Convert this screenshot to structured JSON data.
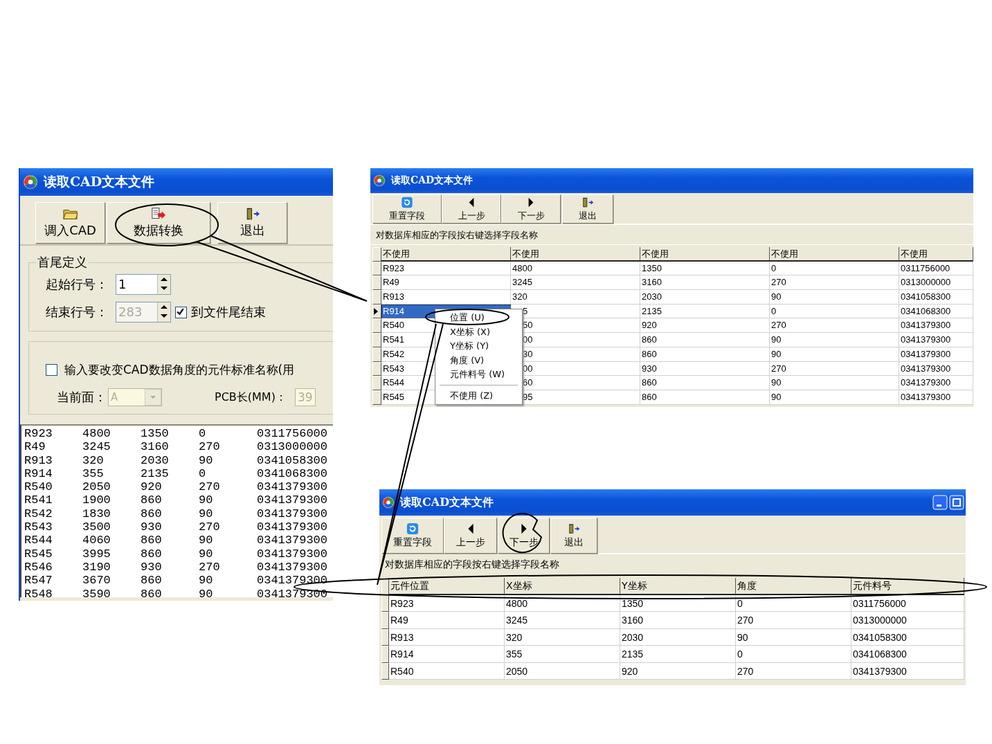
{
  "source_window": {
    "title": "读取CAD文本文件",
    "toolbar": [
      {
        "kind": "load",
        "label": "调入CAD"
      },
      {
        "kind": "convert",
        "label": "数据转换"
      },
      {
        "kind": "exit",
        "label": "退出"
      }
    ],
    "range_group": {
      "title": "首尾定义",
      "start_row": {
        "label": "起始行号：",
        "value": "1",
        "disabled": false
      },
      "end_row": {
        "label": "结束行号：",
        "value": "283",
        "disabled": true
      },
      "to_end": {
        "label": "到文件尾结束",
        "checked": true
      }
    },
    "angle_group": {
      "rotate_parts": {
        "label": "输入要改变CAD数据角度的元件标准名称(用",
        "checked": false
      },
      "side": {
        "label": "当前面：",
        "value": "A",
        "disabled": true
      },
      "pcb_length": {
        "label": "PCB长(MM)：",
        "value": "39"
      }
    },
    "text_rows": [
      [
        "R923",
        "4800",
        "1350",
        "0",
        "0311756000"
      ],
      [
        "R49",
        "3245",
        "3160",
        "270",
        "0313000000"
      ],
      [
        "R913",
        "320",
        "2030",
        "90",
        "0341058300"
      ],
      [
        "R914",
        "355",
        "2135",
        "0",
        "0341068300"
      ],
      [
        "R540",
        "2050",
        "920",
        "270",
        "0341379300"
      ],
      [
        "R541",
        "1900",
        "860",
        "90",
        "0341379300"
      ],
      [
        "R542",
        "1830",
        "860",
        "90",
        "0341379300"
      ],
      [
        "R543",
        "3500",
        "930",
        "270",
        "0341379300"
      ],
      [
        "R544",
        "4060",
        "860",
        "90",
        "0341379300"
      ],
      [
        "R545",
        "3995",
        "860",
        "90",
        "0341379300"
      ],
      [
        "R546",
        "3190",
        "930",
        "270",
        "0341379300"
      ],
      [
        "R547",
        "3670",
        "860",
        "90",
        "0341379300"
      ],
      [
        "R548",
        "3590",
        "860",
        "90",
        "0341379300"
      ]
    ]
  },
  "mapping_window": {
    "title": "读取CAD文本文件",
    "toolbar": [
      {
        "kind": "reset",
        "label": "重置字段"
      },
      {
        "kind": "prev",
        "label": "上一步"
      },
      {
        "kind": "next",
        "label": "下一步"
      },
      {
        "kind": "exit",
        "label": "退出"
      }
    ],
    "hint": "对数据库相应的字段按右键选择字段名称",
    "columns": [
      "不使用",
      "不使用",
      "不使用",
      "不使用",
      "不使用"
    ],
    "rows": [
      {
        "selected": false,
        "cells": [
          "R923",
          "4800",
          "1350",
          "0",
          "0311756000"
        ]
      },
      {
        "selected": false,
        "cells": [
          "R49",
          "3245",
          "3160",
          "270",
          "0313000000"
        ]
      },
      {
        "selected": false,
        "cells": [
          "R913",
          "320",
          "2030",
          "90",
          "0341058300"
        ]
      },
      {
        "selected": true,
        "cells": [
          "R914",
          "5",
          "2135",
          "0",
          "0341068300"
        ]
      },
      {
        "selected": false,
        "cells": [
          "R540",
          "50",
          "920",
          "270",
          "0341379300"
        ]
      },
      {
        "selected": false,
        "cells": [
          "R541",
          "00",
          "860",
          "90",
          "0341379300"
        ]
      },
      {
        "selected": false,
        "cells": [
          "R542",
          "30",
          "860",
          "90",
          "0341379300"
        ]
      },
      {
        "selected": false,
        "cells": [
          "R543",
          "00",
          "930",
          "270",
          "0341379300"
        ]
      },
      {
        "selected": false,
        "cells": [
          "R544",
          "60",
          "860",
          "90",
          "0341379300"
        ]
      },
      {
        "selected": false,
        "cells": [
          "R545",
          "95",
          "860",
          "90",
          "0341379300"
        ]
      }
    ],
    "context_menu": [
      {
        "kind": "item",
        "label": "位置 (U)"
      },
      {
        "kind": "item",
        "label": "X坐标 (X)"
      },
      {
        "kind": "item",
        "label": "Y坐标 (Y)"
      },
      {
        "kind": "item",
        "label": "角度 (V)"
      },
      {
        "kind": "item",
        "label": "元件料号 (W)"
      },
      {
        "kind": "separator"
      },
      {
        "kind": "item",
        "label": "不使用 (Z)"
      }
    ]
  },
  "result_window": {
    "title": "读取CAD文本文件",
    "toolbar": [
      {
        "kind": "reset",
        "label": "重置字段"
      },
      {
        "kind": "prev",
        "label": "上一步"
      },
      {
        "kind": "next",
        "label": "下一步"
      },
      {
        "kind": "exit",
        "label": "退出"
      }
    ],
    "hint": "对数据库相应的字段按右键选择字段名称",
    "columns": [
      "元件位置",
      "X坐标",
      "Y坐标",
      "角度",
      "元件料号"
    ],
    "rows": [
      [
        "R923",
        "4800",
        "1350",
        "0",
        "0311756000"
      ],
      [
        "R49",
        "3245",
        "3160",
        "270",
        "0313000000"
      ],
      [
        "R913",
        "320",
        "2030",
        "90",
        "0341058300"
      ],
      [
        "R914",
        "355",
        "2135",
        "0",
        "0341068300"
      ],
      [
        "R540",
        "2050",
        "920",
        "270",
        "0341379300"
      ]
    ]
  }
}
